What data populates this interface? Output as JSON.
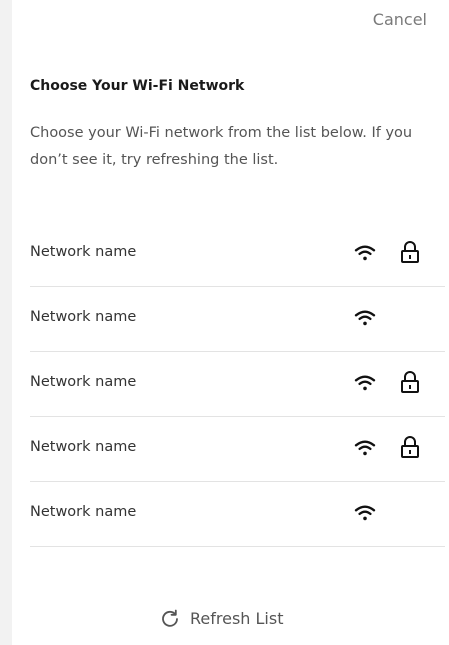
{
  "header": {
    "cancel_label": "Cancel"
  },
  "content": {
    "title": "Choose Your Wi-Fi Network",
    "description": "Choose your Wi-Fi network from the list below. If you don’t see it, try refreshing the list."
  },
  "networks": [
    {
      "name": "Network name",
      "icons": [
        "wifi-icon",
        "lock-icon"
      ],
      "locked": true
    },
    {
      "name": "Network name",
      "icons": [
        "wifi-icon"
      ],
      "locked": false
    },
    {
      "name": "Network name",
      "icons": [
        "wifi-icon",
        "lock-icon"
      ],
      "locked": true
    },
    {
      "name": "Network name",
      "icons": [
        "wifi-icon",
        "lock-icon"
      ],
      "locked": true
    },
    {
      "name": "Network name",
      "icons": [
        "wifi-icon"
      ],
      "locked": false
    }
  ],
  "footer": {
    "refresh_label": "Refresh List",
    "refresh_icon": "refresh-icon"
  },
  "colors": {
    "background": "#ffffff",
    "outer_background": "#f2f2f2",
    "text_primary": "#222222",
    "text_secondary": "#555555",
    "divider": "#e3e3e3"
  }
}
